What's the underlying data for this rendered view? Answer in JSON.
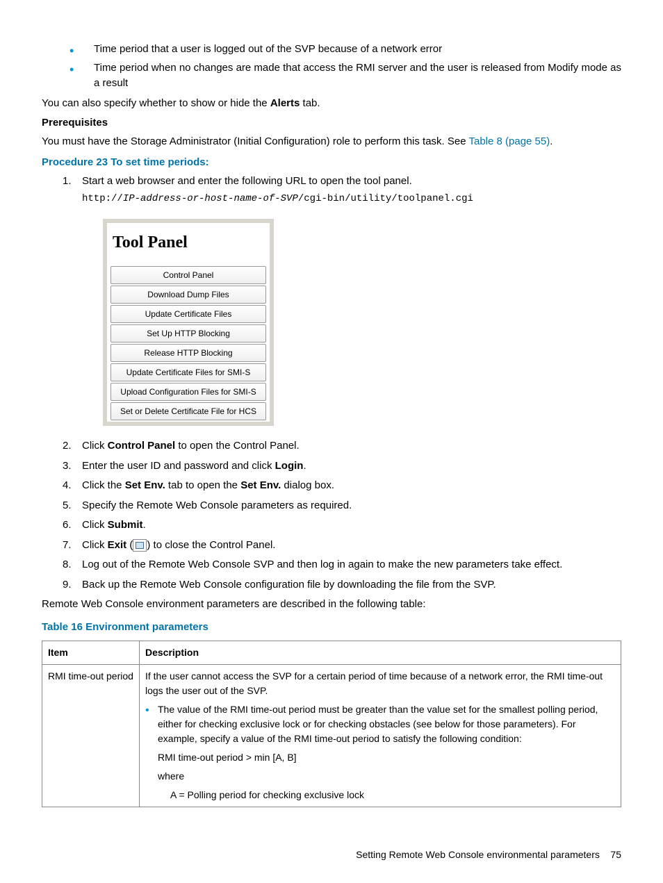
{
  "bullets": [
    "Time period that a user is logged out of the SVP because of a network error",
    "Time period when no changes are made that access the RMI server and the user is released from Modify mode as a result"
  ],
  "intro_para": {
    "pre": "You can also specify whether to show or hide the ",
    "bold": "Alerts",
    "post": " tab."
  },
  "prereq": {
    "heading": "Prerequisites",
    "text": "You must have the Storage Administrator (Initial Configuration) role to perform this task. See ",
    "link": "Table 8 (page 55)"
  },
  "procedure": {
    "heading": "Procedure 23 To set time periods:",
    "step1": {
      "text": "Start a web browser and enter the following URL to open the tool panel.",
      "url_fixed1": "http://",
      "url_var": "IP-address-or-host-name-of-SVP",
      "url_fixed2": "/cgi-bin/utility/toolpanel.cgi"
    },
    "tool_panel": {
      "title": "Tool Panel",
      "buttons": [
        "Control Panel",
        "Download Dump Files",
        "Update Certificate Files",
        "Set Up HTTP Blocking",
        "Release HTTP Blocking",
        "Update Certificate Files for SMI-S",
        "Upload Configuration Files for SMI-S",
        "Set or Delete Certificate File for HCS"
      ]
    },
    "step2": {
      "pre": "Click ",
      "b": "Control Panel",
      "post": " to open the Control Panel."
    },
    "step3": {
      "pre": "Enter the user ID and password and click ",
      "b": "Login",
      "post": "."
    },
    "step4": {
      "pre": "Click the ",
      "b1": "Set Env.",
      "mid": " tab to open the ",
      "b2": "Set Env.",
      "post": " dialog box."
    },
    "step5": "Specify the Remote Web Console parameters as required.",
    "step6": {
      "pre": "Click ",
      "b": "Submit",
      "post": "."
    },
    "step7": {
      "pre": "Click ",
      "b": "Exit",
      "post": ") to close the Control Panel."
    },
    "step8": "Log out of the Remote Web Console SVP and then log in again to make the new parameters take effect.",
    "step9": "Back up the Remote Web Console configuration file by downloading the file from the SVP."
  },
  "outro": "Remote Web Console environment parameters are described in the following table:",
  "table": {
    "caption": "Table 16 Environment parameters",
    "head_item": "Item",
    "head_desc": "Description",
    "row1": {
      "item": "RMI time-out period",
      "p1": "If the user cannot access the SVP for a certain period of time because of a network error, the RMI time-out logs the user out of the SVP.",
      "bullet": "The value of the RMI time-out period must be greater than the value set for the smallest polling period, either for checking exclusive lock or for checking obstacles (see below for those parameters). For example, specify a value of the RMI time-out period to satisfy the following condition:",
      "line1": "RMI time-out period > min [A, B]",
      "line2": "where",
      "line3": "A = Polling period for checking exclusive lock"
    }
  },
  "footer": {
    "text": "Setting Remote Web Console environmental parameters",
    "page": "75"
  }
}
